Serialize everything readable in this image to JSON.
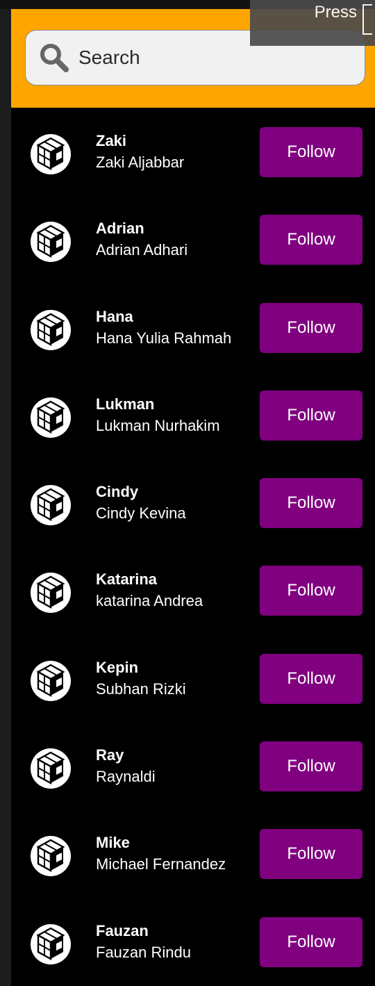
{
  "search": {
    "placeholder": "Search"
  },
  "tooltip": {
    "text": "Press"
  },
  "colors": {
    "header": "#FFA500",
    "follow_button": "#800080",
    "background": "#000000"
  },
  "users": [
    {
      "username": "Zaki",
      "full_name": "Zaki Aljabbar",
      "action": "Follow"
    },
    {
      "username": "Adrian",
      "full_name": "Adrian Adhari",
      "action": "Follow"
    },
    {
      "username": "Hana",
      "full_name": "Hana Yulia Rahmah",
      "action": "Follow"
    },
    {
      "username": "Lukman",
      "full_name": "Lukman Nurhakim",
      "action": "Follow"
    },
    {
      "username": "Cindy",
      "full_name": "Cindy Kevina",
      "action": "Follow"
    },
    {
      "username": "Katarina",
      "full_name": "katarina Andrea",
      "action": "Follow"
    },
    {
      "username": "Kepin",
      "full_name": "Subhan Rizki",
      "action": "Follow"
    },
    {
      "username": "Ray",
      "full_name": "Raynaldi",
      "action": "Follow"
    },
    {
      "username": "Mike",
      "full_name": "Michael Fernandez",
      "action": "Follow"
    },
    {
      "username": "Fauzan",
      "full_name": "Fauzan Rindu",
      "action": "Follow"
    }
  ]
}
